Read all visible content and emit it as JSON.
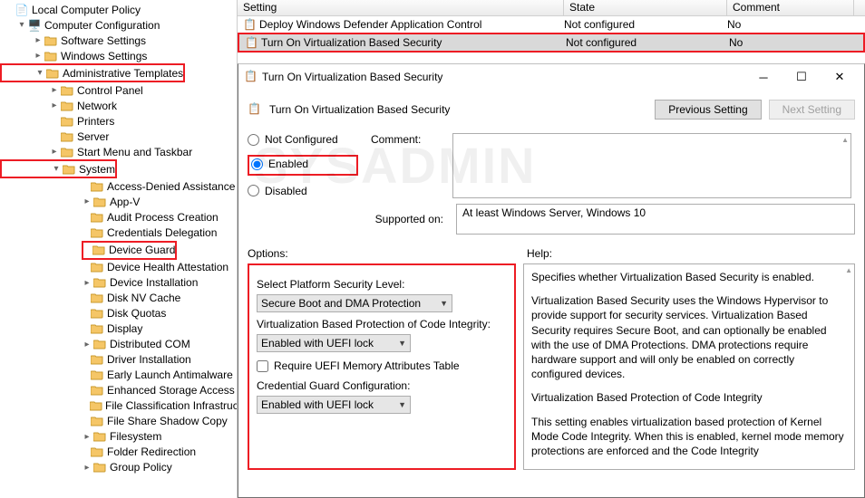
{
  "tree": {
    "root": "Local Computer Policy",
    "computerConfig": "Computer Configuration",
    "softwareSettings": "Software Settings",
    "windowsSettings": "Windows Settings",
    "adminTemplates": "Administrative Templates",
    "controlPanel": "Control Panel",
    "network": "Network",
    "printers": "Printers",
    "server": "Server",
    "startMenu": "Start Menu and Taskbar",
    "system": "System",
    "accessDenied": "Access-Denied Assistance",
    "appv": "App-V",
    "auditProcess": "Audit Process Creation",
    "credDelegation": "Credentials Delegation",
    "deviceGuard": "Device Guard",
    "deviceHealth": "Device Health Attestation",
    "deviceInstall": "Device Installation",
    "diskNv": "Disk NV Cache",
    "diskQuotas": "Disk Quotas",
    "display": "Display",
    "distributedCom": "Distributed COM",
    "driverInstall": "Driver Installation",
    "earlyLaunch": "Early Launch Antimalware",
    "enhancedStorage": "Enhanced Storage Access",
    "fileClass": "File Classification Infrastructure",
    "fileShare": "File Share Shadow Copy",
    "filesystem": "Filesystem",
    "folderRedir": "Folder Redirection",
    "groupPolicy": "Group Policy"
  },
  "list": {
    "colSetting": "Setting",
    "colState": "State",
    "colComment": "Comment",
    "rows": [
      {
        "setting": "Deploy Windows Defender Application Control",
        "state": "Not configured",
        "comment": "No"
      },
      {
        "setting": "Turn On Virtualization Based Security",
        "state": "Not configured",
        "comment": "No"
      }
    ]
  },
  "dialog": {
    "title": "Turn On Virtualization Based Security",
    "headerTitle": "Turn On Virtualization Based Security",
    "prevSetting": "Previous Setting",
    "nextSetting": "Next Setting",
    "notConfigured": "Not Configured",
    "enabled": "Enabled",
    "disabled": "Disabled",
    "commentLabel": "Comment:",
    "supportedLabel": "Supported on:",
    "supportedValue": "At least Windows Server, Windows 10",
    "optionsLabel": "Options:",
    "helpLabel": "Help:",
    "platformLabel": "Select Platform Security Level:",
    "platformValue": "Secure Boot and DMA Protection",
    "vbpci": "Virtualization Based Protection of Code Integrity:",
    "vbpciValue": "Enabled with UEFI lock",
    "uefiCheck": "Require UEFI Memory Attributes Table",
    "credGuardLabel": "Credential Guard Configuration:",
    "credGuardValue": "Enabled with UEFI lock",
    "help": {
      "p1": "Specifies whether Virtualization Based Security is enabled.",
      "p2": "Virtualization Based Security uses the Windows Hypervisor to provide support for security services. Virtualization Based Security requires Secure Boot, and can optionally be enabled with the use of DMA Protections. DMA protections require hardware support and will only be enabled on correctly configured devices.",
      "p3": "Virtualization Based Protection of Code Integrity",
      "p4": "This setting enables virtualization based protection of Kernel Mode Code Integrity. When this is enabled, kernel mode memory protections are enforced and the Code Integrity"
    }
  }
}
